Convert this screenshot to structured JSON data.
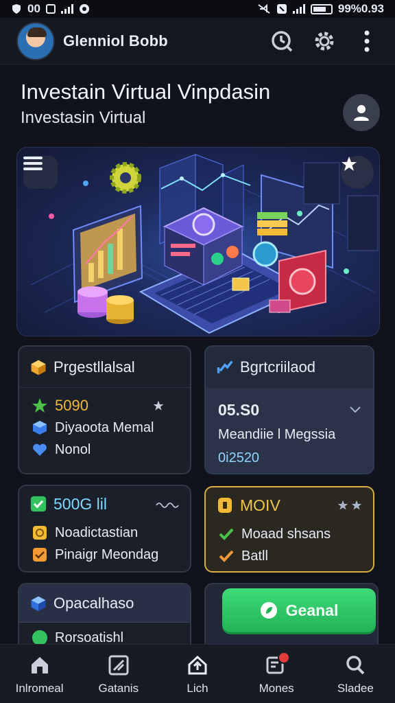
{
  "status_bar": {
    "left_text": "00",
    "right_text": "99%0.93"
  },
  "app_bar": {
    "title": "Glenniol Bobb"
  },
  "header": {
    "title": "Investain Virtual Vinpdasin",
    "subtitle": "Investasin Virtual"
  },
  "cards": {
    "card1": {
      "title": "Prgestllalsal",
      "stat": "5090",
      "row1": "Diyaoota Memal",
      "row2": "Nonol"
    },
    "card2": {
      "title": "Bgrtcriilaod",
      "stat": "05.S0",
      "row1": "Meandiie l Megssia",
      "row2": "0i2520"
    },
    "card3": {
      "title": "500G lil",
      "row1": "Noadictastian",
      "row2": "Pinaigr Meondag"
    },
    "card4": {
      "title": "MOIV",
      "row1": "Moaad shsans",
      "row2": "Batll"
    },
    "card5": {
      "title": "Opacalhaso",
      "row1": "Rorsoatishl"
    },
    "card6": {
      "button_label": "Geanal"
    }
  },
  "bottom_nav": [
    {
      "label": "Inlromeal",
      "icon": "home-icon"
    },
    {
      "label": "Gatanis",
      "icon": "edit-icon"
    },
    {
      "label": "Lich",
      "icon": "upload-icon"
    },
    {
      "label": "Mones",
      "icon": "notification-icon"
    },
    {
      "label": "Sladee",
      "icon": "search-icon"
    }
  ],
  "colors": {
    "accent_green": "#2ecc6a",
    "accent_gold": "#d6b043",
    "background": "#10131c"
  }
}
